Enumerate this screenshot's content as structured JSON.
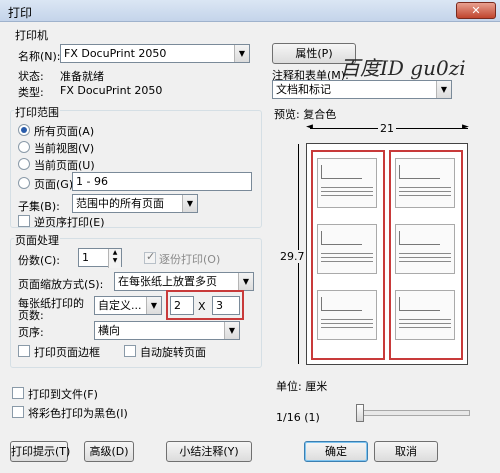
{
  "window": {
    "title": "打印",
    "close": "✕"
  },
  "printer": {
    "group_label": "打印机",
    "name_label": "名称(N):",
    "name_value": "FX DocuPrint 2050",
    "properties_button": "属性(P)",
    "status_label": "状态:",
    "status_value": "准备就绪",
    "type_label": "类型:",
    "type_value": "FX DocuPrint 2050",
    "comments_label": "注释和表单(M):",
    "comments_value": "文档和标记"
  },
  "watermark": "百度ID  gu0zi",
  "range": {
    "group_label": "打印范围",
    "all_pages": "所有页面(A)",
    "current_view": "当前视图(V)",
    "current_page": "当前页面(U)",
    "pages_label": "页面(G)",
    "pages_value": "1 - 96",
    "subset_label": "子集(B):",
    "subset_value": "范围中的所有页面",
    "reverse": "逆页序打印(E)"
  },
  "handling": {
    "group_label": "页面处理",
    "copies_label": "份数(C):",
    "copies_value": "1",
    "collate": "逐份打印(O)",
    "scaling_label": "页面缩放方式(S):",
    "scaling_value": "在每张纸上放置多页",
    "pages_per_sheet_label": "每张纸打印的页数:",
    "pages_per_sheet_value": "自定义...",
    "cols": "2",
    "x_sign": "X",
    "rows": "3",
    "order_label": "页序:",
    "order_value": "横向",
    "print_border": "打印页面边框",
    "auto_rotate": "自动旋转页面"
  },
  "output": {
    "print_to_file": "打印到文件(F)",
    "grayscale": "将彩色打印为黑色(I)"
  },
  "preview": {
    "label": "预览: 复合色",
    "width": "21",
    "height": "29.7",
    "unit_label": "单位: 厘米",
    "page_indicator": "1/16 (1)"
  },
  "buttons": {
    "tips": "打印提示(T)",
    "advanced": "高级(D)",
    "summarize": "小结注释(Y)",
    "ok": "确定",
    "cancel": "取消"
  }
}
